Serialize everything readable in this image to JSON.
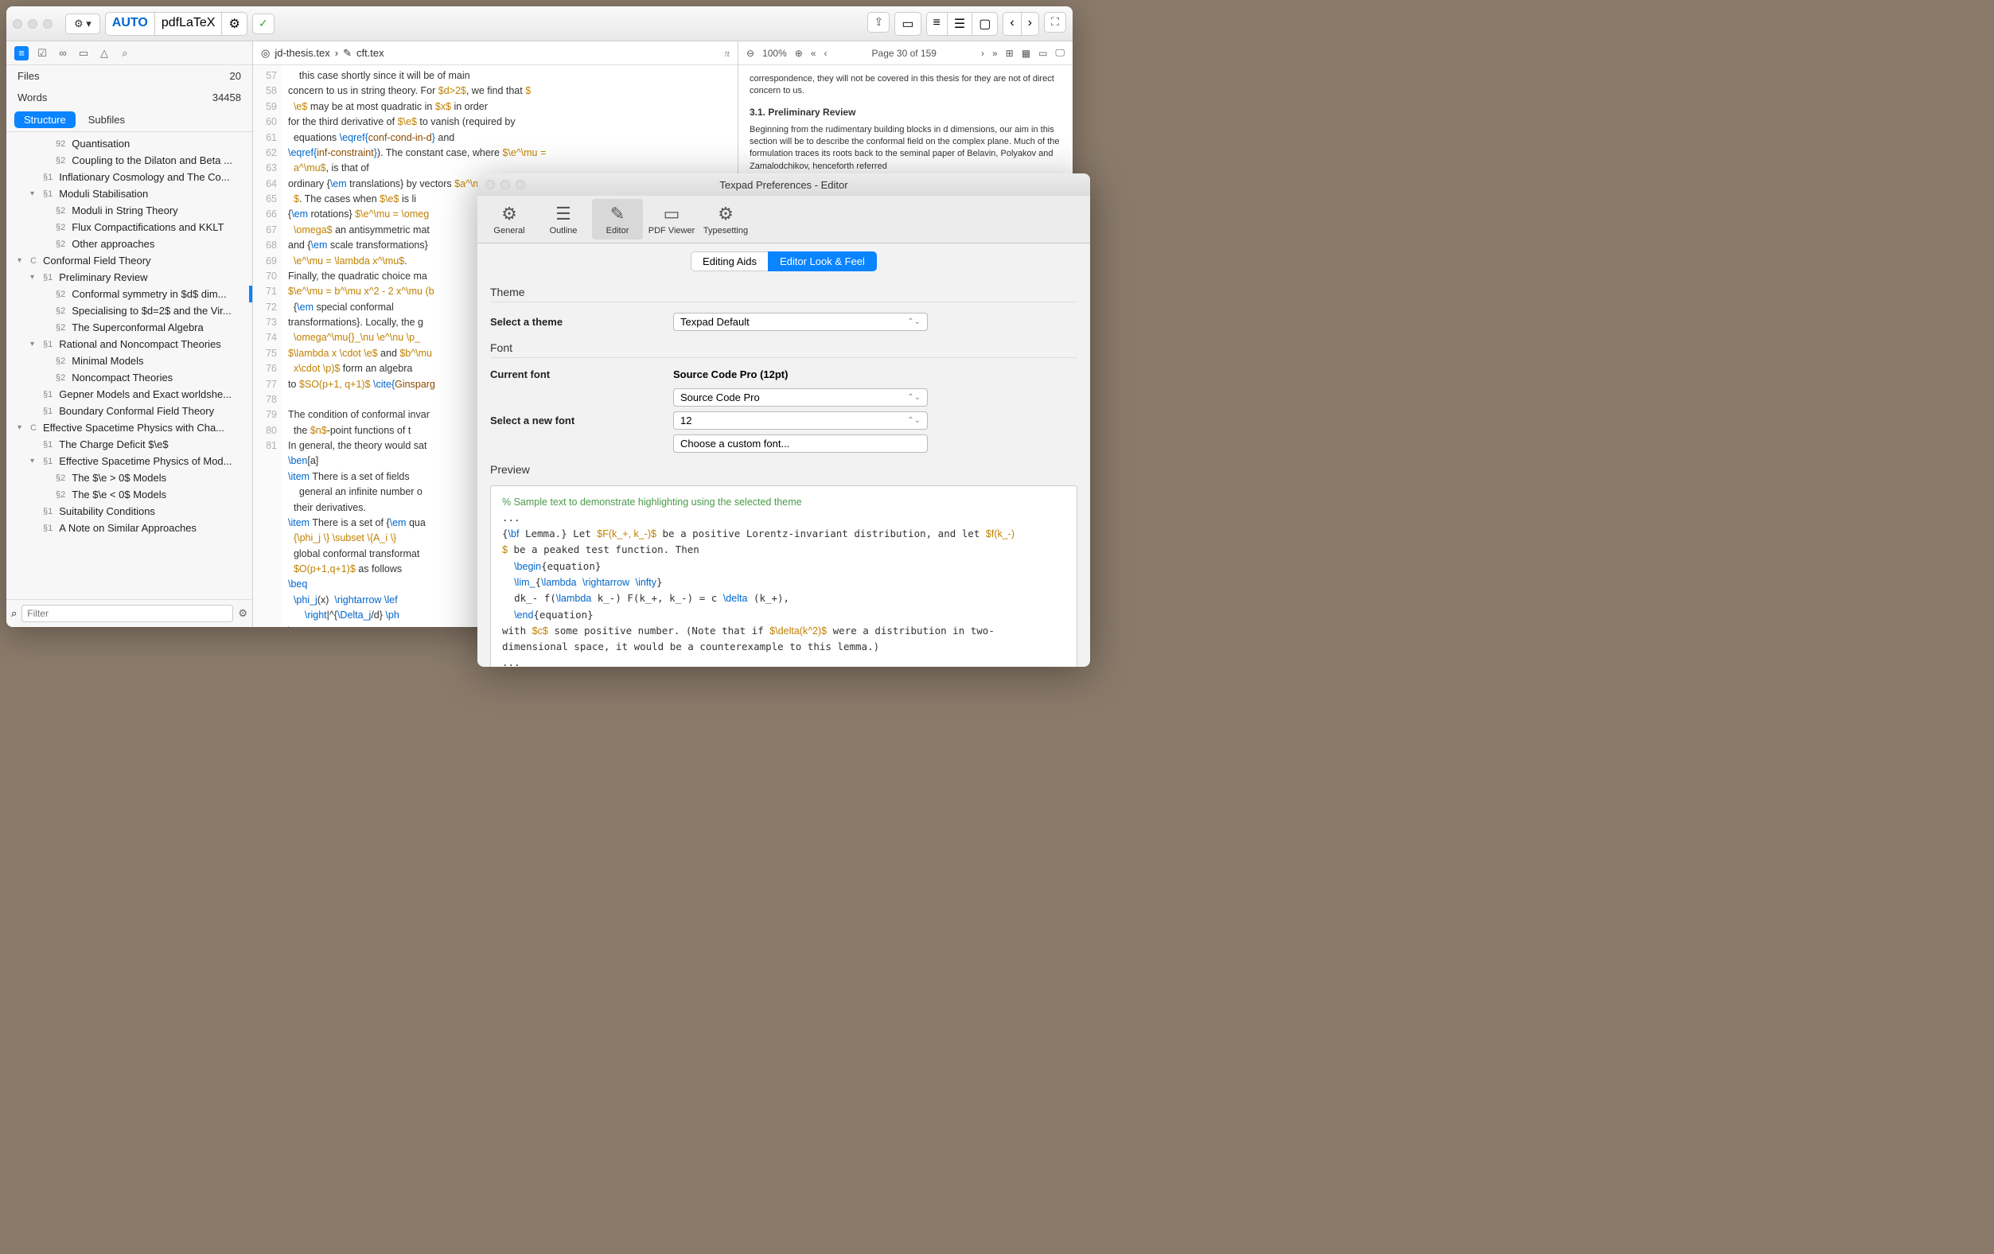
{
  "toolbar": {
    "auto": "AUTO",
    "typeset": "pdfLaTeX"
  },
  "sidebar": {
    "stats": {
      "files_label": "Files",
      "files": "20",
      "words_label": "Words",
      "words": "34458"
    },
    "tabs": {
      "structure": "Structure",
      "subfiles": "Subfiles"
    },
    "filter_placeholder": "Filter",
    "items": [
      {
        "indent": 2,
        "sect": "92",
        "label": "Quantisation"
      },
      {
        "indent": 2,
        "sect": "§2",
        "label": "Coupling to the Dilaton and Beta ..."
      },
      {
        "indent": 1,
        "sect": "§1",
        "label": "Inflationary Cosmology and The Co..."
      },
      {
        "indent": 1,
        "sect": "§1",
        "label": "Moduli Stabilisation",
        "chev": "▾"
      },
      {
        "indent": 2,
        "sect": "§2",
        "label": "Moduli in String Theory"
      },
      {
        "indent": 2,
        "sect": "§2",
        "label": "Flux Compactifications and KKLT"
      },
      {
        "indent": 2,
        "sect": "§2",
        "label": "Other approaches"
      },
      {
        "indent": 0,
        "sect": "C",
        "label": "Conformal Field Theory",
        "chev": "▾"
      },
      {
        "indent": 1,
        "sect": "§1",
        "label": "Preliminary Review",
        "chev": "▾"
      },
      {
        "indent": 2,
        "sect": "§2",
        "label": "Conformal symmetry in $d$ dim...",
        "selected": true
      },
      {
        "indent": 2,
        "sect": "§2",
        "label": "Specialising to $d=2$ and the Vir..."
      },
      {
        "indent": 2,
        "sect": "§2",
        "label": "The Superconformal Algebra"
      },
      {
        "indent": 1,
        "sect": "§1",
        "label": "Rational and Noncompact Theories",
        "chev": "▾"
      },
      {
        "indent": 2,
        "sect": "§2",
        "label": "Minimal Models"
      },
      {
        "indent": 2,
        "sect": "§2",
        "label": "Noncompact Theories"
      },
      {
        "indent": 1,
        "sect": "§1",
        "label": "Gepner Models and Exact worldshe..."
      },
      {
        "indent": 1,
        "sect": "§1",
        "label": "Boundary Conformal Field Theory"
      },
      {
        "indent": 0,
        "sect": "C",
        "label": "Effective Spacetime Physics with Cha...",
        "chev": "▾"
      },
      {
        "indent": 1,
        "sect": "§1",
        "label": "The Charge Deficit $\\e$"
      },
      {
        "indent": 1,
        "sect": "§1",
        "label": "Effective Spacetime Physics of Mod...",
        "chev": "▾"
      },
      {
        "indent": 2,
        "sect": "§2",
        "label": "The $\\e > 0$ Models"
      },
      {
        "indent": 2,
        "sect": "§2",
        "label": "The $\\e < 0$ Models"
      },
      {
        "indent": 1,
        "sect": "§1",
        "label": "Suitability Conditions"
      },
      {
        "indent": 1,
        "sect": "§1",
        "label": "A Note on Similar Approaches"
      }
    ]
  },
  "editor": {
    "breadcrumb": {
      "file1": "jd-thesis.tex",
      "file2": "cft.tex"
    }
  },
  "pdf": {
    "zoom": "100%",
    "page": "Page 30 of 159",
    "body_intro": "correspondence, they will not be covered in this thesis for they are not of direct concern to us.",
    "section": "3.1.  Preliminary Review",
    "para": "Beginning from the rudimentary building blocks in d dimensions, our aim in this section will be to describe the conformal field on the complex plane. Much of the formulation traces its roots back to the seminal paper of Belavin, Polyakov and Zamalodchikov, henceforth referred"
  },
  "prefs": {
    "title": "Texpad Preferences - Editor",
    "tabs": {
      "general": "General",
      "outline": "Outline",
      "editor": "Editor",
      "pdf": "PDF Viewer",
      "typeset": "Typesetting"
    },
    "subtabs": {
      "aids": "Editing Aids",
      "look": "Editor Look & Feel"
    },
    "theme": {
      "heading": "Theme",
      "label": "Select a theme",
      "value": "Texpad Default"
    },
    "font": {
      "heading": "Font",
      "current_label": "Current font",
      "current_value": "Source Code Pro (12pt)",
      "select_label": "Select a new font",
      "name": "Source Code Pro",
      "size": "12",
      "custom": "Choose a custom font..."
    },
    "preview_heading": "Preview"
  }
}
